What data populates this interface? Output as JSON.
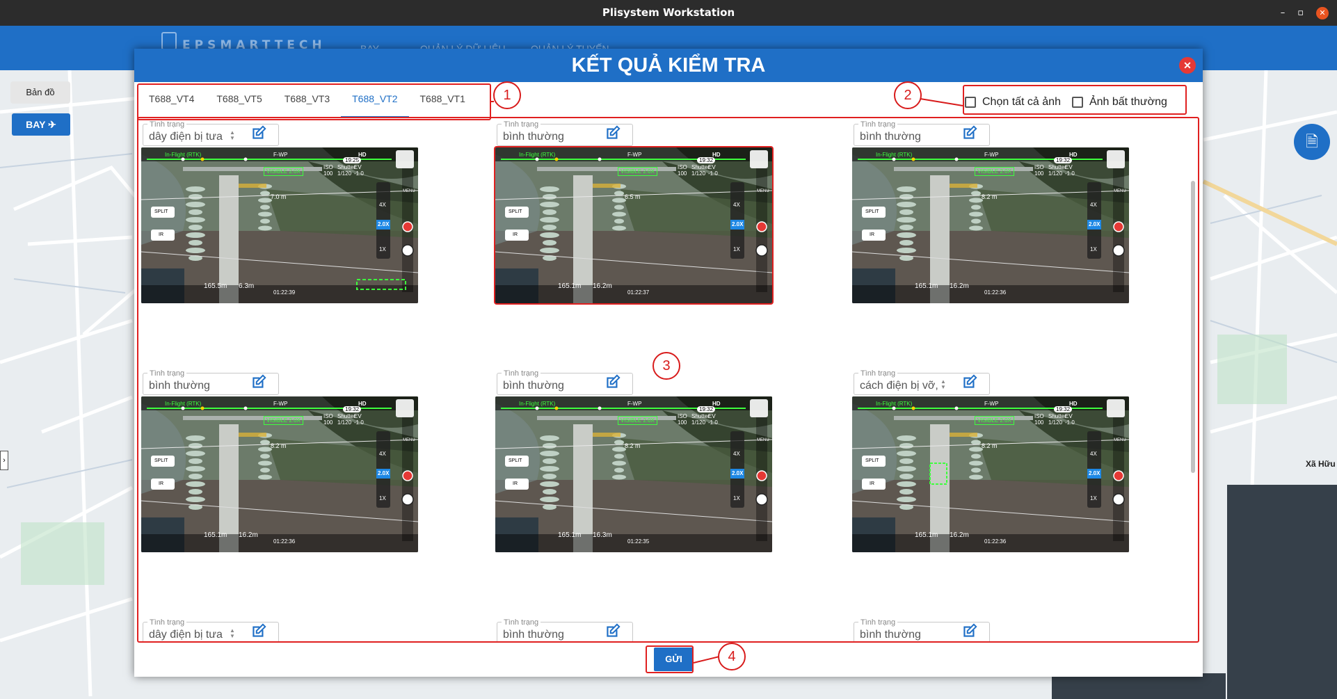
{
  "window": {
    "title": "Plisystem Workstation",
    "min": "–",
    "max": "▫",
    "close": "✕"
  },
  "app": {
    "brand": "EPSMARTTECH",
    "nav": [
      "BAY",
      "QUẢN LÝ DỮ LIỆU",
      "QUẢN LÝ TUYẾN"
    ]
  },
  "map": {
    "side_tab": "Bản đồ",
    "bay_button": "BAY",
    "label": "Xã Hữu"
  },
  "dialog": {
    "title": "KẾT QUẢ KIỂM TRA",
    "close": "✕",
    "tabs": [
      "T688_VT4",
      "T688_VT5",
      "T688_VT3",
      "T688_VT2",
      "T688_VT1"
    ],
    "active_tab": "T688_VT2",
    "options": {
      "select_all": "Chọn tất cả ảnh",
      "abnormal": "Ảnh bất thường"
    },
    "status_label": "Tình trạng",
    "send_button": "GỬI",
    "cards": [
      {
        "status": "dây điện bị tưa",
        "spinner": true,
        "distance": "7.0 m",
        "time": "19:25",
        "alt": "165.5m",
        "hd": "6.3m",
        "clock": "01:22:39",
        "highlight": false
      },
      {
        "status": "bình thường",
        "spinner": false,
        "distance": "6.5 m",
        "time": "19:32",
        "alt": "165.1m",
        "hd": "16.2m",
        "clock": "01:22:37",
        "highlight": true
      },
      {
        "status": "bình thường",
        "spinner": false,
        "distance": "8.2 m",
        "time": "19:32",
        "alt": "165.1m",
        "hd": "16.2m",
        "clock": "01:22:36",
        "highlight": false
      },
      {
        "status": "bình thường",
        "spinner": false,
        "distance": "8.2 m",
        "time": "19:32",
        "alt": "165.1m",
        "hd": "16.2m",
        "clock": "01:22:36",
        "highlight": false
      },
      {
        "status": "bình thường",
        "spinner": false,
        "distance": "8.2 m",
        "time": "19:32",
        "alt": "165.1m",
        "hd": "16.3m",
        "clock": "01:22:35",
        "highlight": false
      },
      {
        "status": "cách điện bị vỡ,",
        "spinner": true,
        "distance": "8.2 m",
        "time": "19:32",
        "alt": "165.1m",
        "hd": "16.2m",
        "clock": "01:22:36",
        "highlight": false
      },
      {
        "status": "dây điện bị tưa",
        "spinner": true
      },
      {
        "status": "bình thường",
        "spinner": false
      },
      {
        "status": "bình thường",
        "spinner": false
      }
    ],
    "hud": {
      "mode": "In-Flight (RTK)",
      "wp": "F-WP",
      "hd": "HD",
      "visible": "VISIBLE 2.0X",
      "split": "SPLIT",
      "ir": "IR",
      "zoom4": "4X",
      "zoom1": "1X",
      "zoomv": "2.0X",
      "menu": "MENU",
      "iso": "ISO",
      "iso_v": "100",
      "shutter": "Shutter",
      "shutter_v": "1/120",
      "ev": "EV",
      "ev_v": "-1.0"
    }
  },
  "markers": [
    "1",
    "2",
    "3",
    "4"
  ],
  "colors": {
    "primary": "#1f6fc6",
    "annotation": "#e02020",
    "close": "#e53935"
  }
}
